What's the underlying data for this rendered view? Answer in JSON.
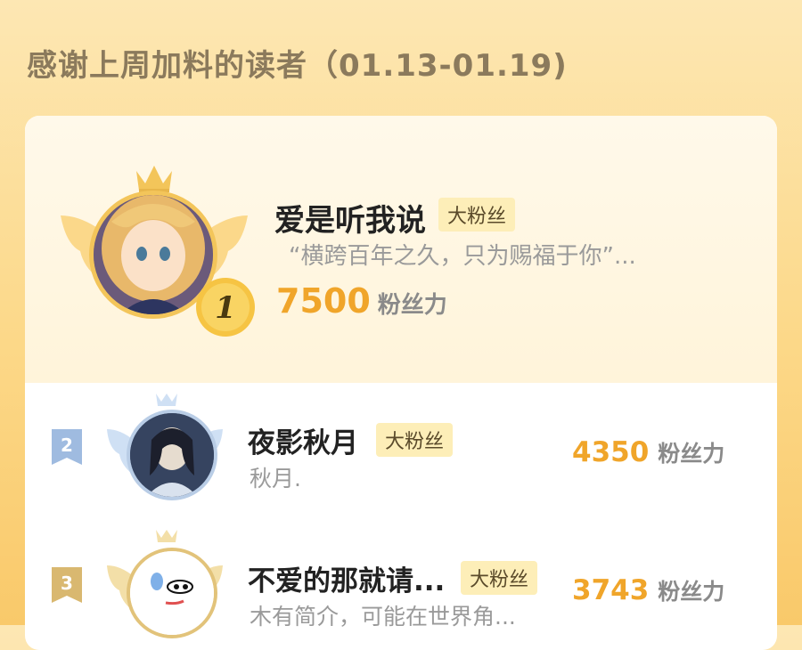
{
  "header": {
    "title": "感谢上周加料的读者（01.13-01.19)"
  },
  "top_fan": {
    "rank": "1",
    "name": "爱是听我说",
    "badge": "大粉丝",
    "quote": "“横跨百年之久，只为赐福于你”...",
    "power_value": "7500",
    "power_unit": "粉丝力",
    "icons": [
      "crown-icon",
      "wings-icon",
      "rank-1-coin-icon"
    ],
    "colors": {
      "accent": "#f0a52a",
      "crown": "#f3c55a"
    }
  },
  "ranked_fans": [
    {
      "rank": "2",
      "name": "夜影秋月",
      "badge": "大粉丝",
      "desc": "秋月.",
      "power_value": "4350",
      "power_unit": "粉丝力",
      "flag_color": "#9fbbe0"
    },
    {
      "rank": "3",
      "name": "不爱的那就请...",
      "badge": "大粉丝",
      "desc": "木有简介，可能在世界角...",
      "power_value": "3743",
      "power_unit": "粉丝力",
      "flag_color": "#d9b870"
    }
  ]
}
